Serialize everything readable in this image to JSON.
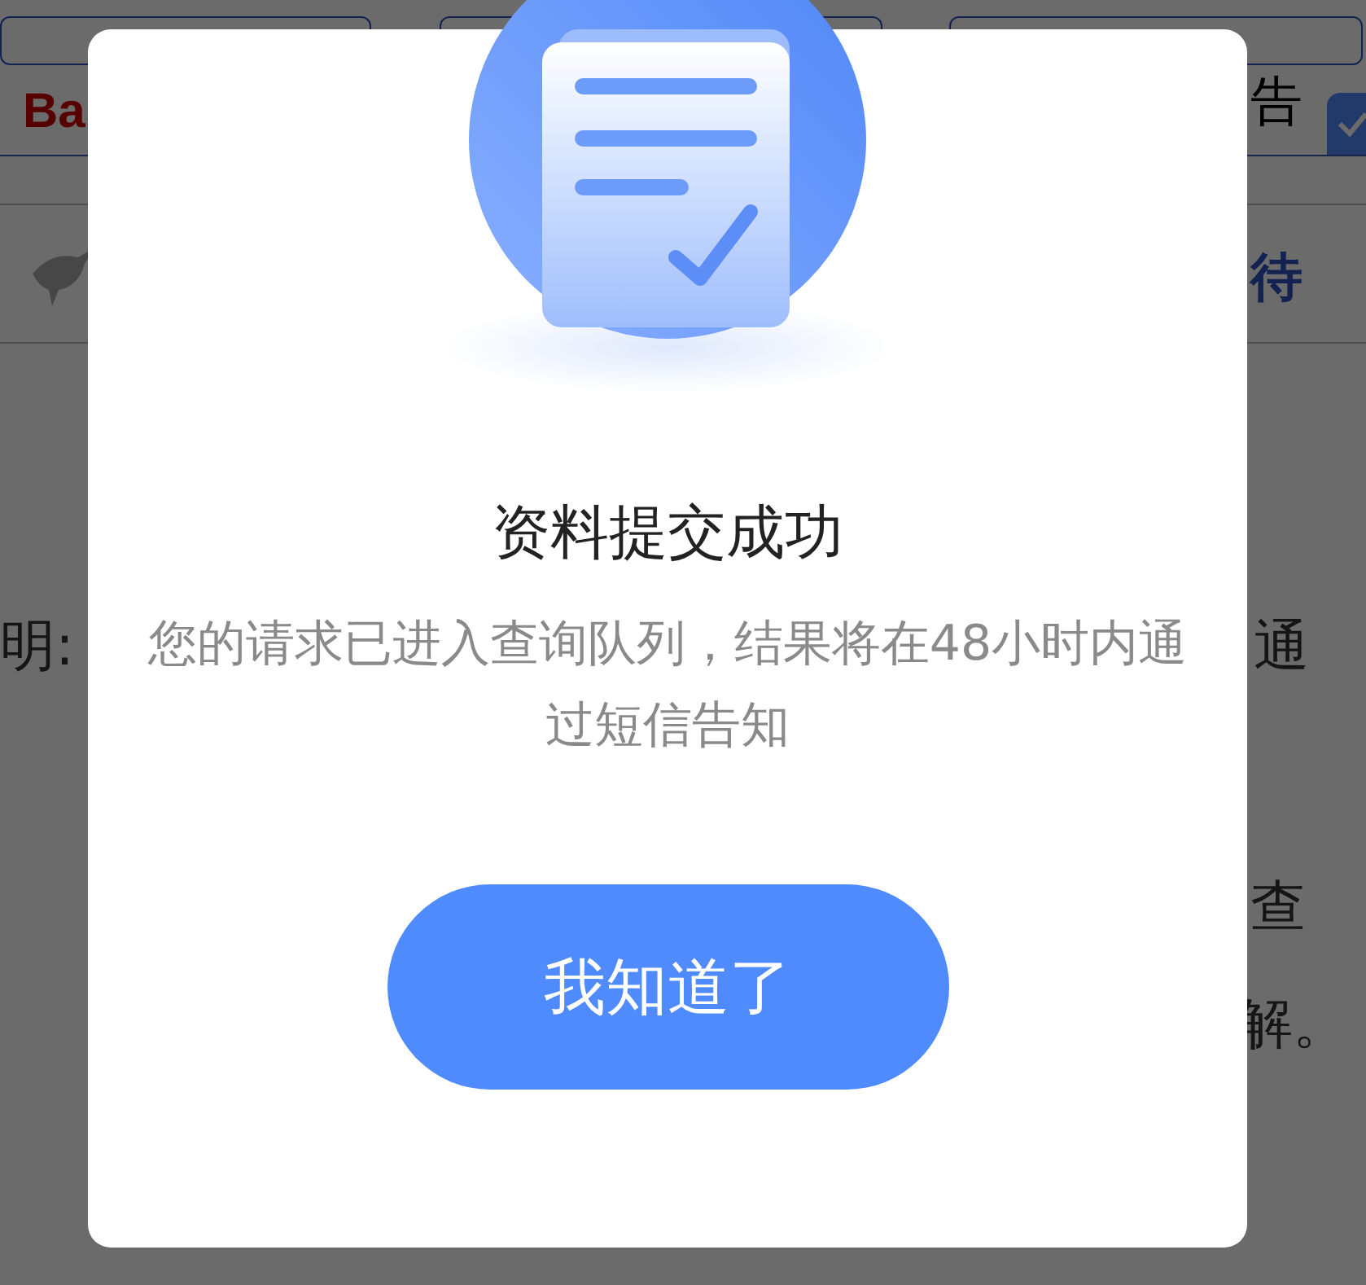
{
  "background": {
    "logo_text": "Ba",
    "header_text": "告",
    "checkbox": {
      "checked": true
    },
    "link_text": "待",
    "texts": [
      "明:",
      "通",
      "查",
      "解。"
    ]
  },
  "dialog": {
    "title": "资料提交成功",
    "message": "您的请求已进入查询队列，结果将在48小时内通过短信告知",
    "button": "我知道了"
  }
}
